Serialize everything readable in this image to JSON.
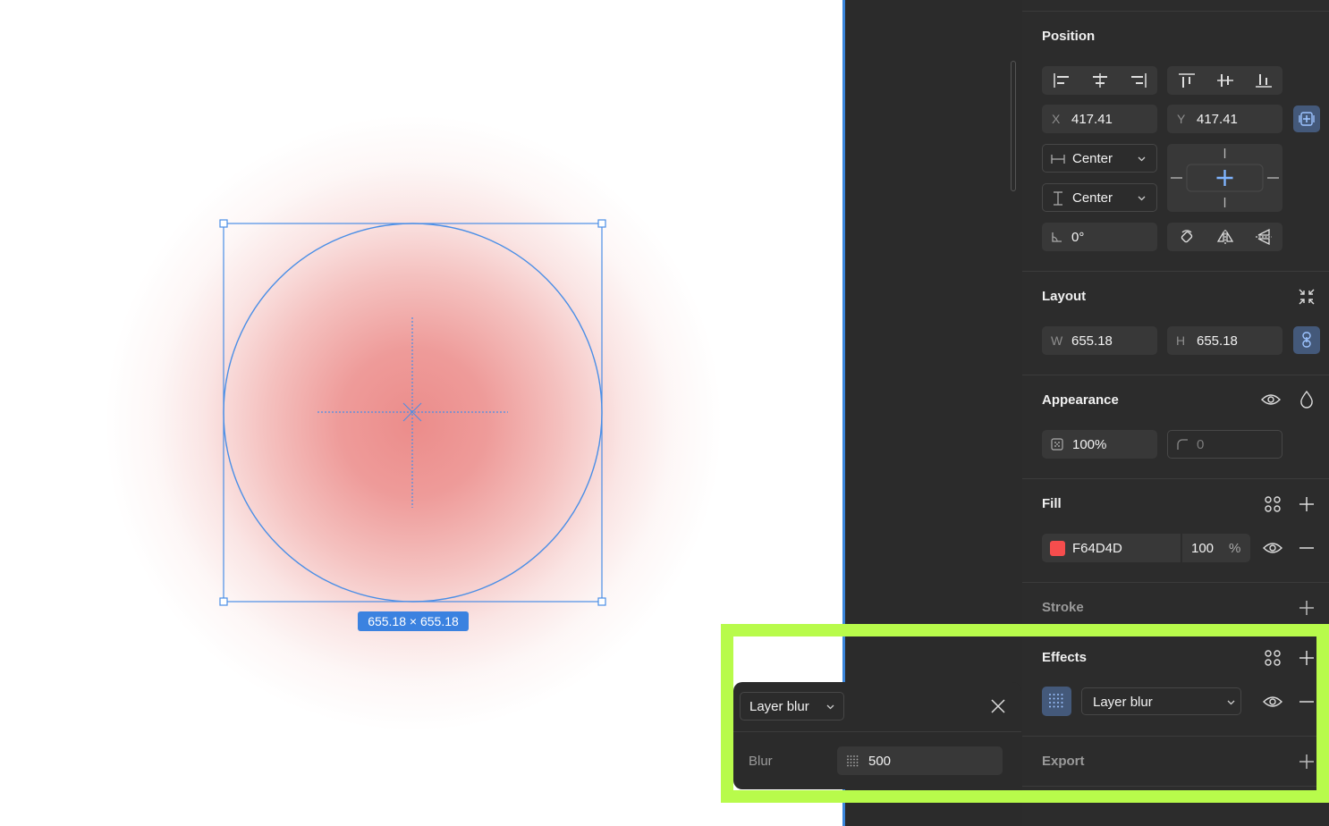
{
  "canvas": {
    "selection_size": "655.18 × 655.18"
  },
  "position": {
    "title": "Position",
    "x_label": "X",
    "x_value": "417.41",
    "y_label": "Y",
    "y_value": "417.41",
    "h_constraint": "Center",
    "v_constraint": "Center",
    "rotation": "0°"
  },
  "layout": {
    "title": "Layout",
    "w_label": "W",
    "w_value": "655.18",
    "h_label": "H",
    "h_value": "655.18"
  },
  "appearance": {
    "title": "Appearance",
    "opacity": "100%",
    "radius": "0"
  },
  "fill": {
    "title": "Fill",
    "hex": "F64D4D",
    "swatch_color": "#F64D4D",
    "opacity": "100",
    "unit": "%"
  },
  "stroke": {
    "title": "Stroke"
  },
  "effects": {
    "title": "Effects",
    "effect_type": "Layer blur"
  },
  "export": {
    "title": "Export"
  },
  "popover": {
    "type": "Layer blur",
    "blur_label": "Blur",
    "blur_value": "500"
  },
  "colors": {
    "highlight": "#B8FB4B",
    "selection": "#3B82E0"
  }
}
